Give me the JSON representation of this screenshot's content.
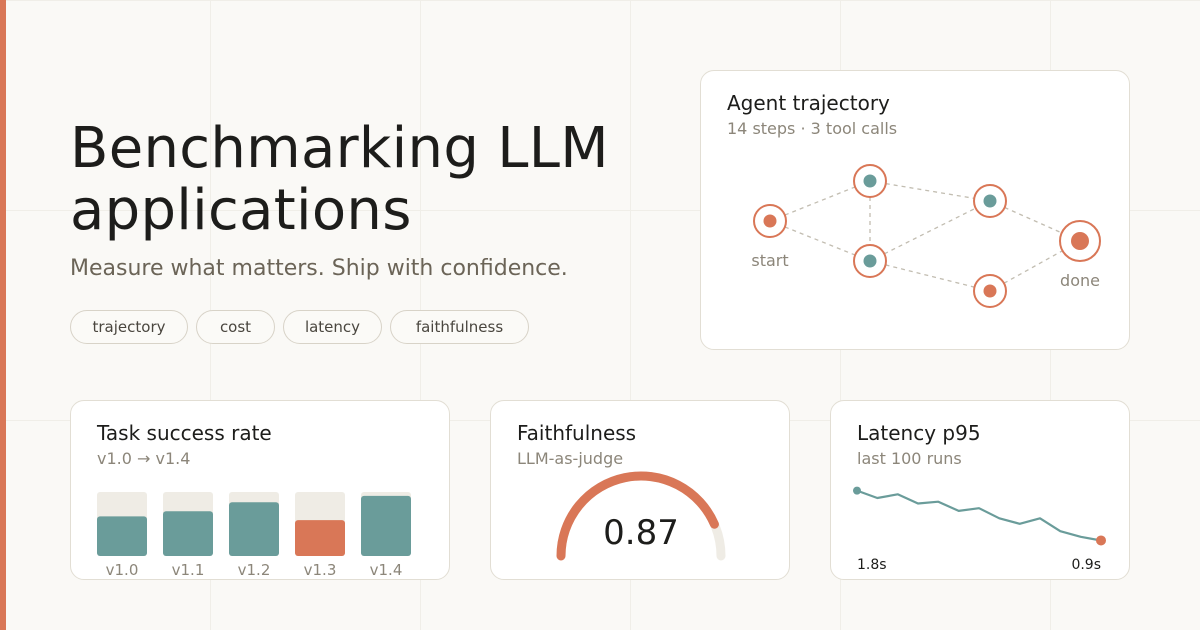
{
  "hero": {
    "title": "Benchmarking LLM applications",
    "subtitle": "Measure what matters. Ship with confidence.",
    "tags": [
      "trajectory",
      "cost",
      "latency",
      "faithfulness"
    ]
  },
  "trajectory_card": {
    "title": "Agent trajectory",
    "subtitle": "14 steps · 3 tool calls",
    "start_label": "start",
    "end_label": "done"
  },
  "success_card": {
    "title": "Task success rate",
    "subtitle": "v1.0 → v1.4"
  },
  "faithfulness_card": {
    "title": "Faithfulness",
    "subtitle": "LLM-as-judge",
    "value": "0.87"
  },
  "latency_card": {
    "title": "Latency p95",
    "subtitle": "last 100 runs",
    "start_label": "1.8s",
    "end_label": "0.9s"
  },
  "colors": {
    "accent": "#d97757",
    "teal": "#6a9c9a",
    "track": "#efece5"
  },
  "chart_data": [
    {
      "type": "bar",
      "categories": [
        "v1.0",
        "v1.1",
        "v1.2",
        "v1.3",
        "v1.4"
      ],
      "values": [
        0.62,
        0.7,
        0.84,
        0.56,
        0.94
      ],
      "highlight_index": 3,
      "ylim": [
        0,
        1
      ],
      "title": "Task success rate",
      "subtitle": "v1.0 → v1.4"
    },
    {
      "type": "gauge",
      "value": 0.87,
      "range": [
        0,
        1
      ],
      "title": "Faithfulness",
      "subtitle": "LLM-as-judge"
    },
    {
      "type": "line",
      "values": [
        1.8,
        1.72,
        1.76,
        1.66,
        1.68,
        1.58,
        1.61,
        1.5,
        1.44,
        1.5,
        1.36,
        1.3,
        1.26
      ],
      "ylim": [
        1.2,
        1.85
      ],
      "title": "Latency p95",
      "subtitle": "last 100 runs",
      "start_label": "1.8s",
      "end_label": "0.9s"
    }
  ]
}
